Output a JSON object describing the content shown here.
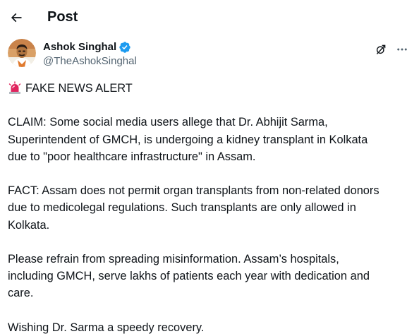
{
  "header": {
    "title": "Post",
    "back_icon": "arrow-left-icon"
  },
  "author": {
    "display_name": "Ashok Singhal",
    "handle": "@TheAshokSinghal",
    "verified_icon": "verified-badge-icon",
    "avatar_icon": "avatar",
    "actions": {
      "grok_icon": "grok-icon",
      "more_icon": "more-horizontal-icon"
    }
  },
  "post": {
    "alert_icon": "siren-icon",
    "alert_text": "FAKE NEWS ALERT",
    "paragraphs": [
      "CLAIM: Some social media users allege that Dr. Abhijit Sarma,\nSuperintendent of GMCH, is undergoing a kidney transplant in Kolkata\ndue to \"poor healthcare infrastructure\" in Assam.",
      "FACT: Assam does not permit organ transplants from non-related donors\ndue to medicolegal regulations. Such transplants are only allowed in\nKolkata.",
      "Please refrain from spreading misinformation. Assam’s hospitals,\nincluding GMCH, serve lakhs of patients each year with dedication and\ncare.",
      "Wishing Dr. Sarma a speedy recovery."
    ]
  },
  "colors": {
    "text_primary": "#0f1419",
    "text_secondary": "#536471",
    "verified_blue": "#1d9bf0",
    "siren_red": "#e0245e"
  }
}
